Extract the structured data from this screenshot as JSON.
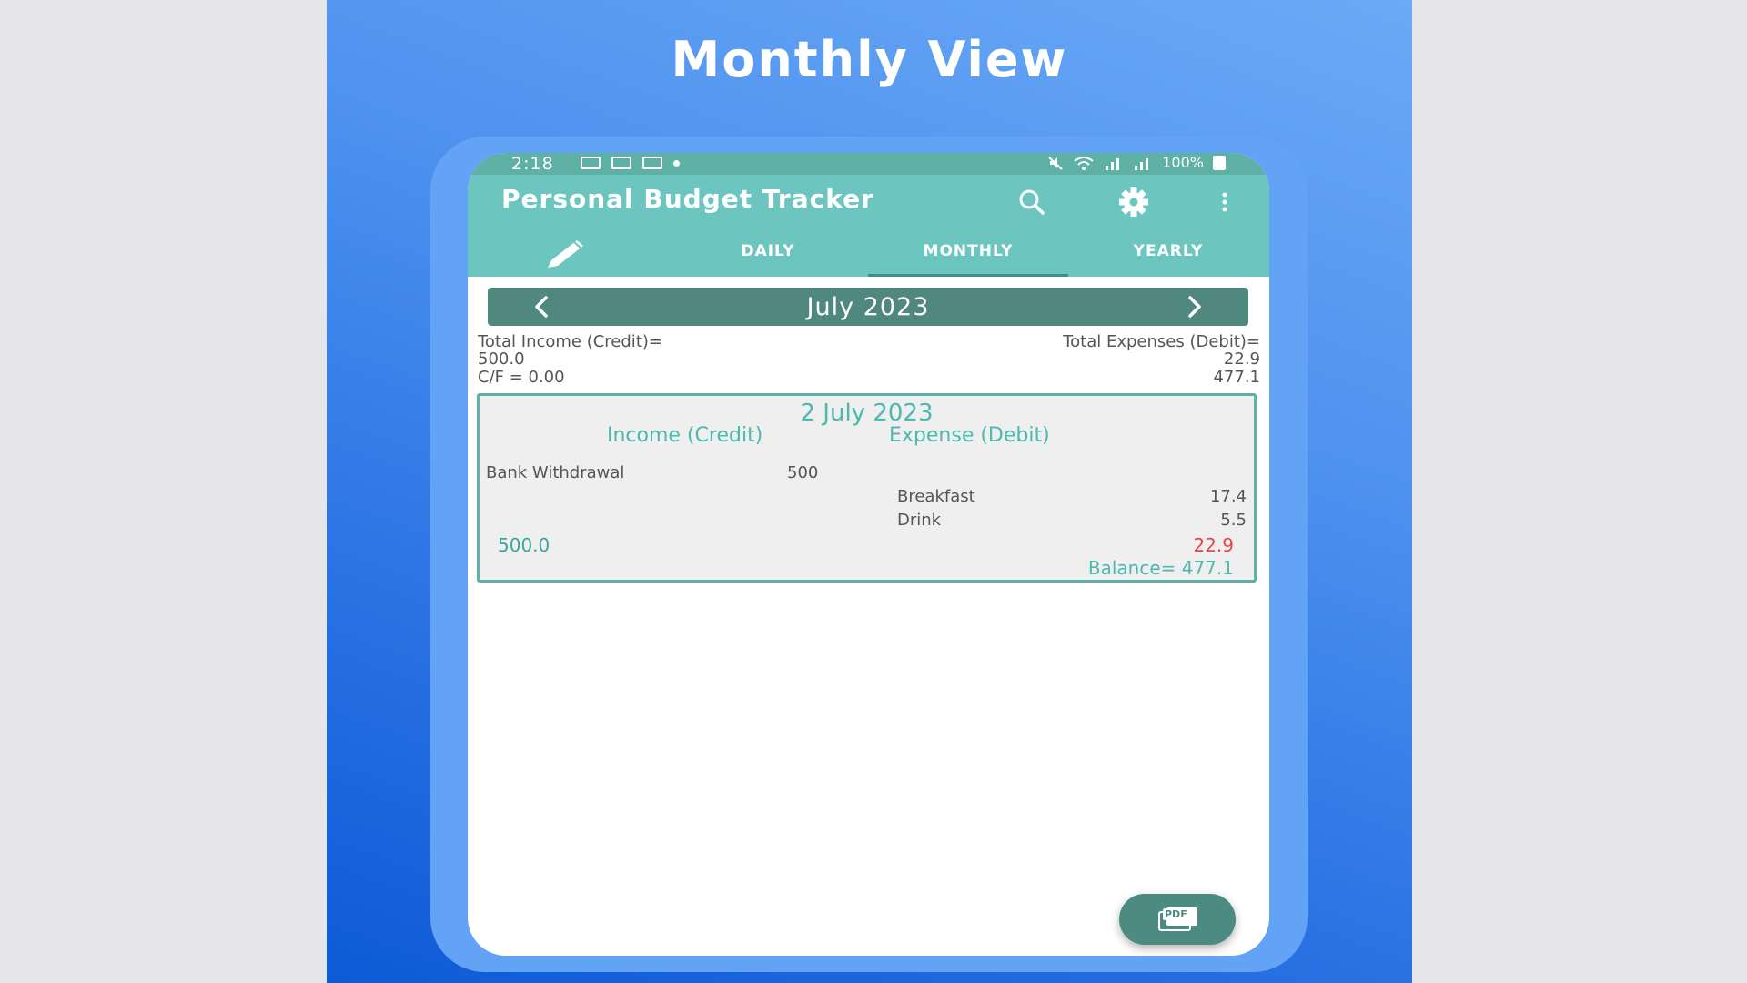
{
  "poster": {
    "title": "Monthly View"
  },
  "status_bar": {
    "time": "2:18",
    "battery": "100%"
  },
  "app_bar": {
    "title": "Personal Budget Tracker"
  },
  "tabs": [
    {
      "label": "DAILY"
    },
    {
      "label": "MONTHLY"
    },
    {
      "label": "YEARLY"
    }
  ],
  "month_nav": {
    "label": "July 2023"
  },
  "summary": {
    "income_label": "Total Income (Credit)=",
    "income_value": "500.0",
    "carry_forward": "C/F = 0.00",
    "expenses_label": "Total Expenses (Debit)=",
    "expenses_value": "22.9",
    "balance_value": "477.1"
  },
  "day_card": {
    "date": "2 July 2023",
    "income_header": "Income (Credit)",
    "expense_header": "Expense (Debit)",
    "income_items": [
      {
        "name": "Bank Withdrawal",
        "amount": "500"
      }
    ],
    "expense_items": [
      {
        "name": "Breakfast",
        "amount": "17.4"
      },
      {
        "name": "Drink",
        "amount": "5.5"
      }
    ],
    "income_total": "500.0",
    "expense_total": "22.9",
    "balance": "Balance= 477.1"
  },
  "fab": {
    "label": "PDF"
  },
  "colors": {
    "primary": "#6cc5bf",
    "dark_teal": "#50887f",
    "accent_text": "#4db8ae",
    "expense_red": "#e34848",
    "poster_blue": "#2b73e4"
  }
}
